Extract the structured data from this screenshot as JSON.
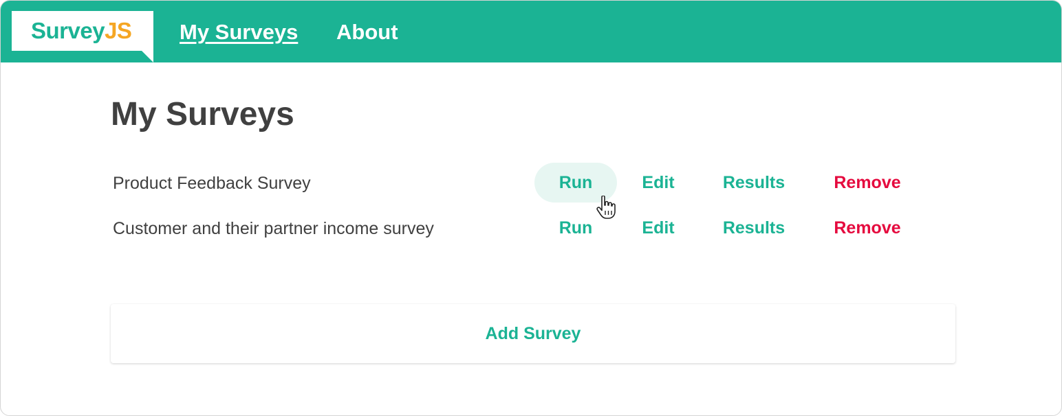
{
  "logo": {
    "part1": "Survey",
    "part2": "JS"
  },
  "nav": {
    "my_surveys": "My Surveys",
    "about": "About"
  },
  "page_title": "My Surveys",
  "surveys": [
    {
      "name": "Product Feedback Survey",
      "run": "Run",
      "edit": "Edit",
      "results": "Results",
      "remove": "Remove"
    },
    {
      "name": "Customer and their partner income survey",
      "run": "Run",
      "edit": "Edit",
      "results": "Results",
      "remove": "Remove"
    }
  ],
  "add_button": "Add Survey",
  "colors": {
    "accent": "#1bb394",
    "logo_orange": "#f5a623",
    "danger": "#e50a3e",
    "text": "#404040",
    "hover_bg": "#e7f6f2"
  },
  "icons": {
    "cursor": "pointer-hand-icon"
  }
}
